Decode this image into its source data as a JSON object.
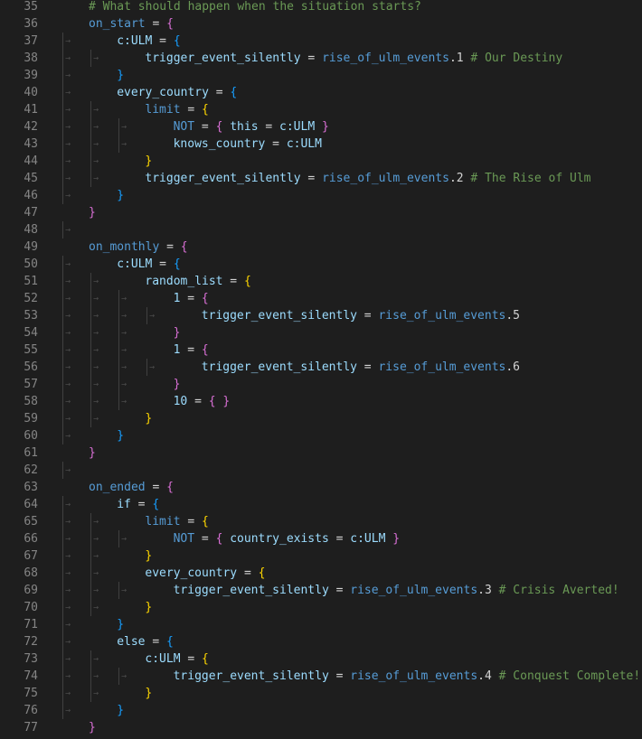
{
  "editor": {
    "colors": {
      "background": "#1e1e1e",
      "line_number": "#858585",
      "comment": "#6a9955",
      "key_blue": "#569cd6",
      "key_light": "#9cdcfe",
      "text": "#d4d4d4",
      "number": "#b5cea8",
      "brace_gold": "#ffd700",
      "brace_pink": "#da70d6",
      "brace_blue": "#179fff",
      "whitespace_dot": "#4a4a4a"
    },
    "lines": [
      {
        "n": "35",
        "indent": 0,
        "tokens": [
          {
            "t": "# What should happen when the situation starts?",
            "c": "comment"
          }
        ]
      },
      {
        "n": "36",
        "indent": 0,
        "tokens": [
          {
            "t": "on_start",
            "c": "key_blue"
          },
          {
            "t": " = ",
            "c": "text"
          },
          {
            "t": "{",
            "c": "brace_pink"
          }
        ]
      },
      {
        "n": "37",
        "indent": 1,
        "tokens": [
          {
            "t": "c:ULM",
            "c": "key_light"
          },
          {
            "t": " = ",
            "c": "text"
          },
          {
            "t": "{",
            "c": "brace_blue"
          }
        ]
      },
      {
        "n": "38",
        "indent": 2,
        "tokens": [
          {
            "t": "trigger_event_silently",
            "c": "key_light"
          },
          {
            "t": " = ",
            "c": "text"
          },
          {
            "t": "rise_of_ulm_events",
            "c": "key_blue"
          },
          {
            "t": ".1",
            "c": "text"
          },
          {
            "t": " # Our Destiny",
            "c": "comment"
          }
        ]
      },
      {
        "n": "39",
        "indent": 1,
        "tokens": [
          {
            "t": "}",
            "c": "brace_blue"
          }
        ]
      },
      {
        "n": "40",
        "indent": 1,
        "tokens": [
          {
            "t": "every_country",
            "c": "key_light"
          },
          {
            "t": " = ",
            "c": "text"
          },
          {
            "t": "{",
            "c": "brace_blue"
          }
        ]
      },
      {
        "n": "41",
        "indent": 2,
        "tokens": [
          {
            "t": "limit",
            "c": "key_blue"
          },
          {
            "t": " = ",
            "c": "text"
          },
          {
            "t": "{",
            "c": "brace_gold"
          }
        ]
      },
      {
        "n": "42",
        "indent": 3,
        "tokens": [
          {
            "t": "NOT",
            "c": "key_blue"
          },
          {
            "t": " = ",
            "c": "text"
          },
          {
            "t": "{",
            "c": "brace_pink"
          },
          {
            "t": " this ",
            "c": "key_light"
          },
          {
            "t": "=",
            "c": "text"
          },
          {
            "t": " c:ULM ",
            "c": "key_light"
          },
          {
            "t": "}",
            "c": "brace_pink"
          }
        ]
      },
      {
        "n": "43",
        "indent": 3,
        "tokens": [
          {
            "t": "knows_country",
            "c": "key_light"
          },
          {
            "t": " = ",
            "c": "text"
          },
          {
            "t": "c:ULM",
            "c": "key_light"
          }
        ]
      },
      {
        "n": "44",
        "indent": 2,
        "tokens": [
          {
            "t": "}",
            "c": "brace_gold"
          }
        ]
      },
      {
        "n": "45",
        "indent": 2,
        "tokens": [
          {
            "t": "trigger_event_silently",
            "c": "key_light"
          },
          {
            "t": " = ",
            "c": "text"
          },
          {
            "t": "rise_of_ulm_events",
            "c": "key_blue"
          },
          {
            "t": ".2",
            "c": "text"
          },
          {
            "t": " # The Rise of Ulm",
            "c": "comment"
          }
        ]
      },
      {
        "n": "46",
        "indent": 1,
        "tokens": [
          {
            "t": "}",
            "c": "brace_blue"
          }
        ]
      },
      {
        "n": "47",
        "indent": 0,
        "tokens": [
          {
            "t": "}",
            "c": "brace_pink"
          }
        ]
      },
      {
        "n": "48",
        "indent": 0,
        "tokens": []
      },
      {
        "n": "49",
        "indent": 0,
        "tokens": [
          {
            "t": "on_monthly",
            "c": "key_blue"
          },
          {
            "t": " = ",
            "c": "text"
          },
          {
            "t": "{",
            "c": "brace_pink"
          }
        ]
      },
      {
        "n": "50",
        "indent": 1,
        "tokens": [
          {
            "t": "c:ULM",
            "c": "key_light"
          },
          {
            "t": " = ",
            "c": "text"
          },
          {
            "t": "{",
            "c": "brace_blue"
          }
        ]
      },
      {
        "n": "51",
        "indent": 2,
        "tokens": [
          {
            "t": "random_list",
            "c": "key_light"
          },
          {
            "t": " = ",
            "c": "text"
          },
          {
            "t": "{",
            "c": "brace_gold"
          }
        ]
      },
      {
        "n": "52",
        "indent": 3,
        "tokens": [
          {
            "t": "1",
            "c": "key_light"
          },
          {
            "t": " = ",
            "c": "text"
          },
          {
            "t": "{",
            "c": "brace_pink"
          }
        ]
      },
      {
        "n": "53",
        "indent": 4,
        "tokens": [
          {
            "t": "trigger_event_silently",
            "c": "key_light"
          },
          {
            "t": " = ",
            "c": "text"
          },
          {
            "t": "rise_of_ulm_events",
            "c": "key_blue"
          },
          {
            "t": ".5",
            "c": "text"
          }
        ]
      },
      {
        "n": "54",
        "indent": 3,
        "tokens": [
          {
            "t": "}",
            "c": "brace_pink"
          }
        ]
      },
      {
        "n": "55",
        "indent": 3,
        "tokens": [
          {
            "t": "1",
            "c": "key_light"
          },
          {
            "t": " = ",
            "c": "text"
          },
          {
            "t": "{",
            "c": "brace_pink"
          }
        ]
      },
      {
        "n": "56",
        "indent": 4,
        "tokens": [
          {
            "t": "trigger_event_silently",
            "c": "key_light"
          },
          {
            "t": " = ",
            "c": "text"
          },
          {
            "t": "rise_of_ulm_events",
            "c": "key_blue"
          },
          {
            "t": ".6",
            "c": "text"
          }
        ]
      },
      {
        "n": "57",
        "indent": 3,
        "tokens": [
          {
            "t": "}",
            "c": "brace_pink"
          }
        ]
      },
      {
        "n": "58",
        "indent": 3,
        "tokens": [
          {
            "t": "10",
            "c": "key_light"
          },
          {
            "t": " = ",
            "c": "text"
          },
          {
            "t": "{",
            "c": "brace_pink"
          },
          {
            "t": " ",
            "c": "text"
          },
          {
            "t": "}",
            "c": "brace_pink"
          }
        ]
      },
      {
        "n": "59",
        "indent": 2,
        "tokens": [
          {
            "t": "}",
            "c": "brace_gold"
          }
        ]
      },
      {
        "n": "60",
        "indent": 1,
        "tokens": [
          {
            "t": "}",
            "c": "brace_blue"
          }
        ]
      },
      {
        "n": "61",
        "indent": 0,
        "tokens": [
          {
            "t": "}",
            "c": "brace_pink"
          }
        ]
      },
      {
        "n": "62",
        "indent": 0,
        "tokens": []
      },
      {
        "n": "63",
        "indent": 0,
        "tokens": [
          {
            "t": "on_ended",
            "c": "key_blue"
          },
          {
            "t": " = ",
            "c": "text"
          },
          {
            "t": "{",
            "c": "brace_pink"
          }
        ]
      },
      {
        "n": "64",
        "indent": 1,
        "tokens": [
          {
            "t": "if",
            "c": "key_light"
          },
          {
            "t": " = ",
            "c": "text"
          },
          {
            "t": "{",
            "c": "brace_blue"
          }
        ]
      },
      {
        "n": "65",
        "indent": 2,
        "tokens": [
          {
            "t": "limit",
            "c": "key_blue"
          },
          {
            "t": " = ",
            "c": "text"
          },
          {
            "t": "{",
            "c": "brace_gold"
          }
        ]
      },
      {
        "n": "66",
        "indent": 3,
        "tokens": [
          {
            "t": "NOT",
            "c": "key_blue"
          },
          {
            "t": " = ",
            "c": "text"
          },
          {
            "t": "{",
            "c": "brace_pink"
          },
          {
            "t": " country_exists ",
            "c": "key_light"
          },
          {
            "t": "=",
            "c": "text"
          },
          {
            "t": " c:ULM ",
            "c": "key_light"
          },
          {
            "t": "}",
            "c": "brace_pink"
          }
        ]
      },
      {
        "n": "67",
        "indent": 2,
        "tokens": [
          {
            "t": "}",
            "c": "brace_gold"
          }
        ]
      },
      {
        "n": "68",
        "indent": 2,
        "tokens": [
          {
            "t": "every_country",
            "c": "key_light"
          },
          {
            "t": " = ",
            "c": "text"
          },
          {
            "t": "{",
            "c": "brace_gold"
          }
        ]
      },
      {
        "n": "69",
        "indent": 3,
        "tokens": [
          {
            "t": "trigger_event_silently",
            "c": "key_light"
          },
          {
            "t": " = ",
            "c": "text"
          },
          {
            "t": "rise_of_ulm_events",
            "c": "key_blue"
          },
          {
            "t": ".3",
            "c": "text"
          },
          {
            "t": " # Crisis Averted!",
            "c": "comment"
          }
        ]
      },
      {
        "n": "70",
        "indent": 2,
        "tokens": [
          {
            "t": "}",
            "c": "brace_gold"
          }
        ]
      },
      {
        "n": "71",
        "indent": 1,
        "tokens": [
          {
            "t": "}",
            "c": "brace_blue"
          }
        ]
      },
      {
        "n": "72",
        "indent": 1,
        "tokens": [
          {
            "t": "else",
            "c": "key_light"
          },
          {
            "t": " = ",
            "c": "text"
          },
          {
            "t": "{",
            "c": "brace_blue"
          }
        ]
      },
      {
        "n": "73",
        "indent": 2,
        "tokens": [
          {
            "t": "c:ULM",
            "c": "key_light"
          },
          {
            "t": " = ",
            "c": "text"
          },
          {
            "t": "{",
            "c": "brace_gold"
          }
        ]
      },
      {
        "n": "74",
        "indent": 3,
        "tokens": [
          {
            "t": "trigger_event_silently",
            "c": "key_light"
          },
          {
            "t": " = ",
            "c": "text"
          },
          {
            "t": "rise_of_ulm_events",
            "c": "key_blue"
          },
          {
            "t": ".4",
            "c": "text"
          },
          {
            "t": " # Conquest Complete!",
            "c": "comment"
          }
        ]
      },
      {
        "n": "75",
        "indent": 2,
        "tokens": [
          {
            "t": "}",
            "c": "brace_gold"
          }
        ]
      },
      {
        "n": "76",
        "indent": 1,
        "tokens": [
          {
            "t": "}",
            "c": "brace_blue"
          }
        ]
      },
      {
        "n": "77",
        "indent": 0,
        "tokens": [
          {
            "t": "}",
            "c": "brace_pink"
          }
        ]
      }
    ]
  }
}
